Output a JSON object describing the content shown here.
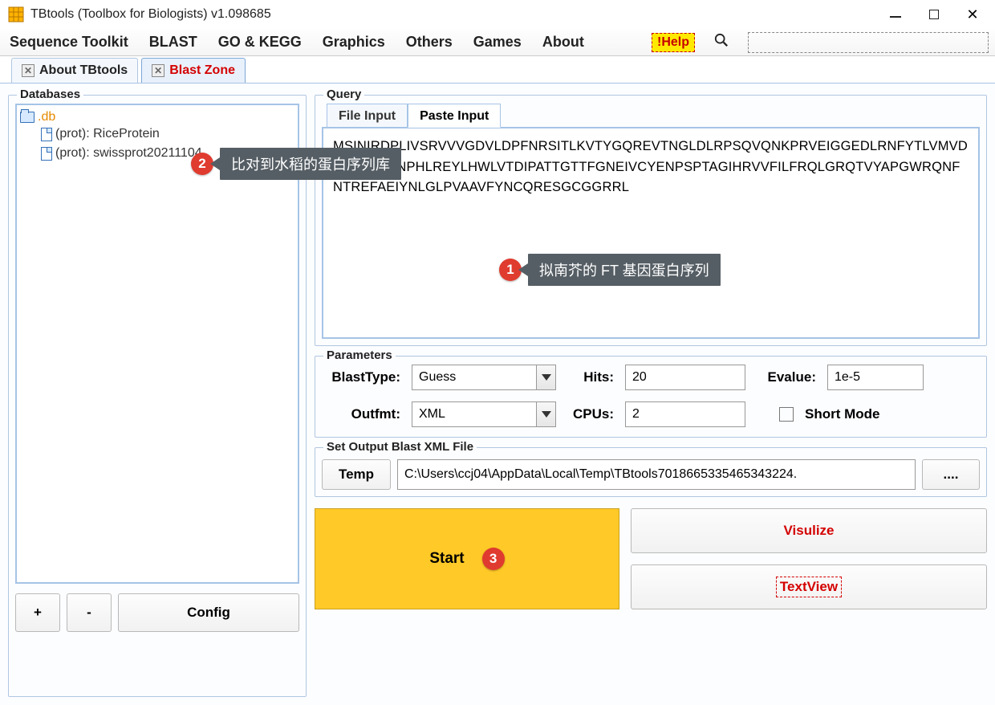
{
  "window": {
    "title": "TBtools (Toolbox for Biologists) v1.098685"
  },
  "menubar": {
    "items": [
      "Sequence Toolkit",
      "BLAST",
      "GO & KEGG",
      "Graphics",
      "Others",
      "Games",
      "About"
    ],
    "help_label": "!Help"
  },
  "tabs": {
    "items": [
      {
        "label": "About TBtools",
        "active": false
      },
      {
        "label": "Blast Zone",
        "active": true
      }
    ]
  },
  "databases": {
    "legend": "Databases",
    "root": ".db",
    "items": [
      "(prot): RiceProtein",
      "(prot): swissprot20211104"
    ],
    "buttons": {
      "add": "+",
      "remove": "-",
      "config": "Config"
    }
  },
  "query": {
    "legend": "Query",
    "tabs": {
      "file": "File Input",
      "paste": "Paste Input"
    },
    "sequence": "MSINIRDPLIVSRVVVGDVLDPFNRSITLKVTYGQREVTNGLDLRPSQVQNKPRVEIGGEDLRNFYTLVMVDPDVPSPSNPHLREYLHWLVTDIPATTGTTFGNEIVCYENPSPTAGIHRVVFILFRQLGRQTVYAPGWRQNFNTREFAEIYNLGLPVAAVFYNCQRESGCGGRRL"
  },
  "parameters": {
    "legend": "Parameters",
    "labels": {
      "blasttype": "BlastType:",
      "hits": "Hits:",
      "evalue": "Evalue:",
      "outfmt": "Outfmt:",
      "cpus": "CPUs:",
      "shortmode": "Short Mode"
    },
    "values": {
      "blasttype": "Guess",
      "hits": "20",
      "evalue": "1e-5",
      "outfmt": "XML",
      "cpus": "2"
    }
  },
  "output": {
    "legend": "Set Output Blast XML File",
    "temp_label": "Temp",
    "path": "C:\\Users\\ccj04\\AppData\\Local\\Temp\\TBtools7018665335465343224.",
    "browse_label": "...."
  },
  "actions": {
    "start": "Start",
    "visualize": "Visulize",
    "textview": "TextView"
  },
  "annotations": {
    "a1": {
      "num": "1",
      "text": "拟南芥的 FT 基因蛋白序列"
    },
    "a2": {
      "num": "2",
      "text": "比对到水稻的蛋白序列库"
    },
    "a3": {
      "num": "3"
    }
  }
}
